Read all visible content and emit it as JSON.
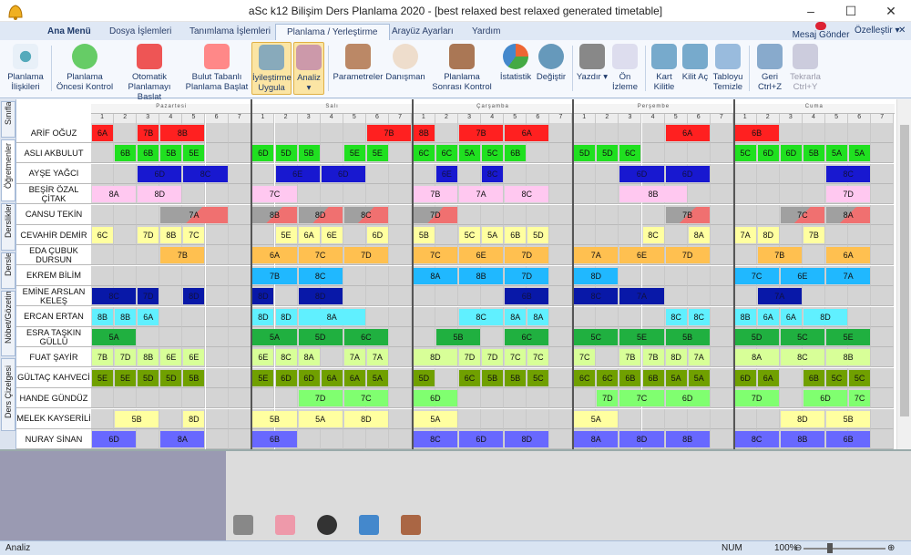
{
  "window": {
    "title": "aSc k12 Bilişim Ders Planlama 2020 - [best relaxed best relaxed generated timetable]",
    "minimize": "–",
    "maximize": "☐",
    "close": "✕"
  },
  "tabs": {
    "menu": "Ana Menü",
    "dosya": "Dosya İşlemleri",
    "tanim": "Tanımlama İşlemleri",
    "planlama": "Planlama / Yerleştirme",
    "arayuz": "Arayüz Ayarları",
    "yardim": "Yardım"
  },
  "mesaj": "Mesaj Gönder",
  "ozel": "Özelleştir ▾",
  "close_x": "✕",
  "ribbon": {
    "b1": "Planlama İlişkileri",
    "b2": "Planlama Öncesi Kontrol",
    "b3": "Otomatik Planlamayı Başlat",
    "b4": "Bulut Tabanlı Planlama Başlat",
    "b5": "İyileştirme Uygula",
    "b6": "Analiz ▾",
    "b7": "Parametreler",
    "b8": "Danışman",
    "b9": "Planlama Sonrası Kontrol",
    "b10": "İstatistik",
    "b11": "Değiştir",
    "b12": "Yazdır ▾",
    "b13": "Ön İzleme",
    "b14": "Kart Kilitle",
    "b15": "Kilit Aç",
    "b16": "Tabloyu Temizle",
    "b17": "Geri Ctrl+Z",
    "b18": "Tekrarla Ctrl+Y"
  },
  "sidetabs": [
    "Sınıflar",
    "Öğretmenler",
    "Derslikler",
    "Dersler",
    "Nöbet/Gözetim",
    "Ders Çizelgesi"
  ],
  "days": [
    "Pazartesi",
    "Salı",
    "Çarşamba",
    "Perşembe",
    "Cuma"
  ],
  "periods": [
    "1",
    "2",
    "3",
    "4",
    "5",
    "6",
    "7"
  ],
  "colors": {
    "6A": "#ff2020",
    "7B": "#ff2020",
    "8B": "#ff2020",
    "6B": "#20e020",
    "5B": "#20e020",
    "5E": "#20e020",
    "6D": "#20e020",
    "5D": "#20e020",
    "6C": "#20e020",
    "5A": "#20e020",
    "5C": "#20e020",
    "8C": "#1818d0",
    "8A": "#ffc8f0",
    "8D": "#ffc8f0",
    "7C": "#ffc8f0",
    "7A": "#ffc8f0",
    "7D": "#ffc8f0",
    "6E": "#ffff90",
    "blue": "#1818d0",
    "orange": "#ffc050",
    "sky": "#20b8ff",
    "navy": "#0818a8",
    "cyan": "#60f0ff",
    "green2": "#20b040",
    "lime": "#d8ff98",
    "olive": "#70a000",
    "lgreen": "#80ff70",
    "yel": "#ffffa8",
    "vio": "#6868ff"
  },
  "teachers": [
    {
      "name": "ARİF OĞUZ",
      "style": "red",
      "slots": [
        [
          0,
          0,
          1,
          "6A"
        ],
        [
          0,
          2,
          1,
          "7B"
        ],
        [
          0,
          3,
          2,
          "8B"
        ],
        [
          1,
          5,
          2,
          "7B"
        ],
        [
          2,
          0,
          1,
          "8B"
        ],
        [
          2,
          2,
          2,
          "7B"
        ],
        [
          2,
          4,
          2,
          "6A"
        ],
        [
          3,
          4,
          2,
          "6A"
        ],
        [
          4,
          0,
          2,
          "6B"
        ]
      ]
    },
    {
      "name": "ASLI AKBULUT",
      "style": "green",
      "slots": [
        [
          0,
          1,
          1,
          "6B"
        ],
        [
          0,
          2,
          1,
          "6B"
        ],
        [
          0,
          3,
          1,
          "5B"
        ],
        [
          0,
          4,
          1,
          "5E"
        ],
        [
          1,
          0,
          1,
          "6D"
        ],
        [
          1,
          1,
          1,
          "5D"
        ],
        [
          1,
          2,
          1,
          "5B"
        ],
        [
          1,
          4,
          1,
          "5E"
        ],
        [
          1,
          5,
          1,
          "5E"
        ],
        [
          2,
          0,
          1,
          "6C"
        ],
        [
          2,
          1,
          1,
          "6C"
        ],
        [
          2,
          2,
          1,
          "5A"
        ],
        [
          2,
          3,
          1,
          "5C"
        ],
        [
          2,
          4,
          1,
          "6B"
        ],
        [
          3,
          0,
          1,
          "5D"
        ],
        [
          3,
          1,
          1,
          "5D"
        ],
        [
          3,
          2,
          1,
          "6C"
        ],
        [
          4,
          0,
          1,
          "5C"
        ],
        [
          4,
          1,
          1,
          "6D"
        ],
        [
          4,
          2,
          1,
          "6D"
        ],
        [
          4,
          3,
          1,
          "5B"
        ],
        [
          4,
          4,
          1,
          "5A"
        ],
        [
          4,
          5,
          1,
          "5A"
        ]
      ]
    },
    {
      "name": "AYŞE YAĞCI",
      "style": "blue",
      "slots": [
        [
          0,
          2,
          2,
          "6D"
        ],
        [
          0,
          4,
          2,
          "8C"
        ],
        [
          1,
          1,
          2,
          "6E"
        ],
        [
          1,
          3,
          2,
          "6D"
        ],
        [
          2,
          1,
          1,
          "6E"
        ],
        [
          2,
          3,
          1,
          "8C"
        ],
        [
          3,
          2,
          2,
          "6D"
        ],
        [
          3,
          4,
          2,
          "6D"
        ],
        [
          4,
          4,
          2,
          "8C"
        ]
      ]
    },
    {
      "name": "BEŞİR ÖZAL ÇİTAK",
      "style": "pink",
      "slots": [
        [
          0,
          0,
          2,
          "8A"
        ],
        [
          0,
          2,
          2,
          "8D"
        ],
        [
          1,
          0,
          2,
          "7C"
        ],
        [
          2,
          0,
          2,
          "7B"
        ],
        [
          2,
          2,
          2,
          "7A"
        ],
        [
          2,
          4,
          2,
          "8C"
        ],
        [
          3,
          2,
          3,
          "8B"
        ],
        [
          4,
          4,
          2,
          "7D"
        ]
      ]
    },
    {
      "name": "CANSU TEKİN",
      "style": "gray",
      "slots": [
        [
          0,
          3,
          3,
          "7A"
        ],
        [
          1,
          0,
          2,
          "8B"
        ],
        [
          1,
          2,
          2,
          "8D"
        ],
        [
          1,
          4,
          2,
          "8C"
        ],
        [
          2,
          0,
          2,
          "7D"
        ],
        [
          3,
          4,
          2,
          "7B"
        ],
        [
          4,
          2,
          2,
          "7C"
        ],
        [
          4,
          4,
          2,
          "8A"
        ]
      ]
    },
    {
      "name": "CEVAHİR DEMİR",
      "style": "yel",
      "slots": [
        [
          0,
          0,
          1,
          "6C"
        ],
        [
          0,
          2,
          1,
          "7D"
        ],
        [
          0,
          3,
          1,
          "8B"
        ],
        [
          0,
          4,
          1,
          "7C"
        ],
        [
          1,
          1,
          1,
          "5E"
        ],
        [
          1,
          2,
          1,
          "6A"
        ],
        [
          1,
          3,
          1,
          "6E"
        ],
        [
          1,
          5,
          1,
          "6D"
        ],
        [
          2,
          0,
          1,
          "5B"
        ],
        [
          2,
          2,
          1,
          "5C"
        ],
        [
          2,
          3,
          1,
          "5A"
        ],
        [
          2,
          4,
          1,
          "6B"
        ],
        [
          2,
          5,
          1,
          "5D"
        ],
        [
          3,
          3,
          1,
          "8C"
        ],
        [
          3,
          5,
          1,
          "8A"
        ],
        [
          4,
          0,
          1,
          "7A"
        ],
        [
          4,
          1,
          1,
          "8D"
        ],
        [
          4,
          3,
          1,
          "7B"
        ]
      ]
    },
    {
      "name": "EDA ÇUBUK DURSUN",
      "style": "orange",
      "slots": [
        [
          0,
          3,
          2,
          "7B"
        ],
        [
          1,
          0,
          2,
          "6A"
        ],
        [
          1,
          2,
          2,
          "7C"
        ],
        [
          1,
          4,
          2,
          "7D"
        ],
        [
          2,
          0,
          2,
          "7C"
        ],
        [
          2,
          2,
          2,
          "6E"
        ],
        [
          2,
          4,
          2,
          "7D"
        ],
        [
          3,
          0,
          2,
          "7A"
        ],
        [
          3,
          2,
          2,
          "6E"
        ],
        [
          3,
          4,
          2,
          "7D"
        ],
        [
          4,
          1,
          2,
          "7B"
        ],
        [
          4,
          4,
          2,
          "6A"
        ]
      ]
    },
    {
      "name": "EKREM BİLİM",
      "style": "sky",
      "slots": [
        [
          1,
          0,
          2,
          "7B"
        ],
        [
          1,
          2,
          2,
          "8C"
        ],
        [
          2,
          0,
          2,
          "8A"
        ],
        [
          2,
          2,
          2,
          "8B"
        ],
        [
          2,
          4,
          2,
          "7D"
        ],
        [
          3,
          0,
          2,
          "8D"
        ],
        [
          4,
          0,
          2,
          "7C"
        ],
        [
          4,
          2,
          2,
          "6E"
        ],
        [
          4,
          4,
          2,
          "7A"
        ]
      ]
    },
    {
      "name": "EMİNE ARSLAN KELEŞ",
      "style": "navy",
      "slots": [
        [
          0,
          0,
          2,
          "8C"
        ],
        [
          0,
          2,
          1,
          "7D"
        ],
        [
          0,
          4,
          1,
          "8D"
        ],
        [
          1,
          0,
          1,
          "8D"
        ],
        [
          1,
          2,
          2,
          "8D"
        ],
        [
          2,
          4,
          2,
          "6B"
        ],
        [
          3,
          0,
          2,
          "8C"
        ],
        [
          3,
          2,
          2,
          "7A"
        ],
        [
          4,
          1,
          2,
          "7A"
        ]
      ]
    },
    {
      "name": "ERCAN ERTAN",
      "style": "cyan",
      "slots": [
        [
          0,
          0,
          1,
          "8B"
        ],
        [
          0,
          1,
          1,
          "8B"
        ],
        [
          0,
          2,
          1,
          "6A"
        ],
        [
          1,
          0,
          1,
          "8D"
        ],
        [
          1,
          1,
          1,
          "8D"
        ],
        [
          1,
          2,
          3,
          "8A"
        ],
        [
          2,
          2,
          2,
          "8C"
        ],
        [
          2,
          4,
          1,
          "8A"
        ],
        [
          2,
          5,
          1,
          "8A"
        ],
        [
          3,
          4,
          1,
          "8C"
        ],
        [
          3,
          5,
          1,
          "8C"
        ],
        [
          4,
          0,
          1,
          "8B"
        ],
        [
          4,
          1,
          1,
          "6A"
        ],
        [
          4,
          2,
          1,
          "6A"
        ],
        [
          4,
          3,
          2,
          "8D"
        ]
      ]
    },
    {
      "name": "ESRA TAŞKIN GÜLLÜ",
      "style": "green2",
      "slots": [
        [
          0,
          0,
          2,
          "5A"
        ],
        [
          1,
          0,
          2,
          "5A"
        ],
        [
          1,
          2,
          2,
          "5D"
        ],
        [
          1,
          4,
          2,
          "6C"
        ],
        [
          2,
          1,
          2,
          "5B"
        ],
        [
          2,
          4,
          2,
          "6C"
        ],
        [
          3,
          0,
          2,
          "5C"
        ],
        [
          3,
          2,
          2,
          "5E"
        ],
        [
          3,
          4,
          2,
          "5B"
        ],
        [
          4,
          0,
          2,
          "5D"
        ],
        [
          4,
          2,
          2,
          "5C"
        ],
        [
          4,
          4,
          2,
          "5E"
        ]
      ]
    },
    {
      "name": "FUAT ŞAYİR",
      "style": "lime",
      "slots": [
        [
          0,
          0,
          1,
          "7B"
        ],
        [
          0,
          1,
          1,
          "7D"
        ],
        [
          0,
          2,
          1,
          "8B"
        ],
        [
          0,
          3,
          1,
          "6E"
        ],
        [
          0,
          4,
          1,
          "6E"
        ],
        [
          1,
          0,
          1,
          "6E"
        ],
        [
          1,
          1,
          1,
          "8C"
        ],
        [
          1,
          2,
          1,
          "8A"
        ],
        [
          1,
          4,
          1,
          "7A"
        ],
        [
          1,
          5,
          1,
          "7A"
        ],
        [
          2,
          0,
          2,
          "8D"
        ],
        [
          2,
          2,
          1,
          "7D"
        ],
        [
          2,
          3,
          1,
          "7D"
        ],
        [
          2,
          4,
          1,
          "7C"
        ],
        [
          2,
          5,
          1,
          "7C"
        ],
        [
          3,
          0,
          1,
          "7C"
        ],
        [
          3,
          2,
          1,
          "7B"
        ],
        [
          3,
          3,
          1,
          "7B"
        ],
        [
          3,
          4,
          1,
          "8D"
        ],
        [
          3,
          5,
          1,
          "7A"
        ],
        [
          4,
          0,
          2,
          "8A"
        ],
        [
          4,
          2,
          2,
          "8C"
        ],
        [
          4,
          4,
          2,
          "8B"
        ]
      ]
    },
    {
      "name": "GÜLTAÇ KAHVECİ",
      "style": "olive",
      "slots": [
        [
          0,
          0,
          1,
          "5E"
        ],
        [
          0,
          1,
          1,
          "5E"
        ],
        [
          0,
          2,
          1,
          "5D"
        ],
        [
          0,
          3,
          1,
          "5D"
        ],
        [
          0,
          4,
          1,
          "5B"
        ],
        [
          1,
          0,
          1,
          "5E"
        ],
        [
          1,
          1,
          1,
          "6D"
        ],
        [
          1,
          2,
          1,
          "6D"
        ],
        [
          1,
          3,
          1,
          "6A"
        ],
        [
          1,
          4,
          1,
          "6A"
        ],
        [
          1,
          5,
          1,
          "5A"
        ],
        [
          2,
          0,
          1,
          "5D"
        ],
        [
          2,
          2,
          1,
          "6C"
        ],
        [
          2,
          3,
          1,
          "5B"
        ],
        [
          2,
          4,
          1,
          "5B"
        ],
        [
          2,
          5,
          1,
          "5C"
        ],
        [
          3,
          0,
          1,
          "6C"
        ],
        [
          3,
          1,
          1,
          "6C"
        ],
        [
          3,
          2,
          1,
          "6B"
        ],
        [
          3,
          3,
          1,
          "6B"
        ],
        [
          3,
          4,
          1,
          "5A"
        ],
        [
          3,
          5,
          1,
          "5A"
        ],
        [
          4,
          0,
          1,
          "6D"
        ],
        [
          4,
          1,
          1,
          "6A"
        ],
        [
          4,
          3,
          1,
          "6B"
        ],
        [
          4,
          4,
          1,
          "5C"
        ],
        [
          4,
          5,
          1,
          "5C"
        ]
      ]
    },
    {
      "name": "HANDE GÜNDÜZ",
      "style": "lgreen",
      "slots": [
        [
          1,
          2,
          2,
          "7D"
        ],
        [
          1,
          4,
          2,
          "7C"
        ],
        [
          2,
          0,
          2,
          "6D"
        ],
        [
          3,
          1,
          1,
          "7D"
        ],
        [
          3,
          2,
          2,
          "7C"
        ],
        [
          3,
          4,
          2,
          "6D"
        ],
        [
          4,
          0,
          2,
          "7D"
        ],
        [
          4,
          3,
          2,
          "6D"
        ],
        [
          4,
          5,
          1,
          "7C"
        ]
      ]
    },
    {
      "name": "MELEK KAYSERİLİ",
      "style": "yel",
      "slots": [
        [
          0,
          1,
          2,
          "5B"
        ],
        [
          0,
          4,
          1,
          "8D"
        ],
        [
          1,
          0,
          2,
          "5B"
        ],
        [
          1,
          2,
          2,
          "5A"
        ],
        [
          1,
          4,
          2,
          "8D"
        ],
        [
          2,
          0,
          2,
          "5A"
        ],
        [
          3,
          0,
          2,
          "5A"
        ],
        [
          4,
          2,
          2,
          "8D"
        ],
        [
          4,
          4,
          2,
          "5B"
        ]
      ]
    },
    {
      "name": "NURAY SİNAN",
      "style": "vio",
      "slots": [
        [
          0,
          0,
          2,
          "6D"
        ],
        [
          0,
          3,
          2,
          "8A"
        ],
        [
          1,
          0,
          2,
          "6B"
        ],
        [
          2,
          0,
          2,
          "8C"
        ],
        [
          2,
          2,
          2,
          "6D"
        ],
        [
          2,
          4,
          2,
          "8D"
        ],
        [
          3,
          0,
          2,
          "8A"
        ],
        [
          3,
          2,
          2,
          "8D"
        ],
        [
          3,
          4,
          2,
          "8B"
        ],
        [
          4,
          0,
          2,
          "8C"
        ],
        [
          4,
          2,
          2,
          "8B"
        ],
        [
          4,
          4,
          2,
          "6B"
        ]
      ]
    }
  ],
  "status": {
    "left": "Analiz",
    "num": "NUM",
    "zoom": "100%",
    "minus": "⊖",
    "plus": "⊕"
  }
}
